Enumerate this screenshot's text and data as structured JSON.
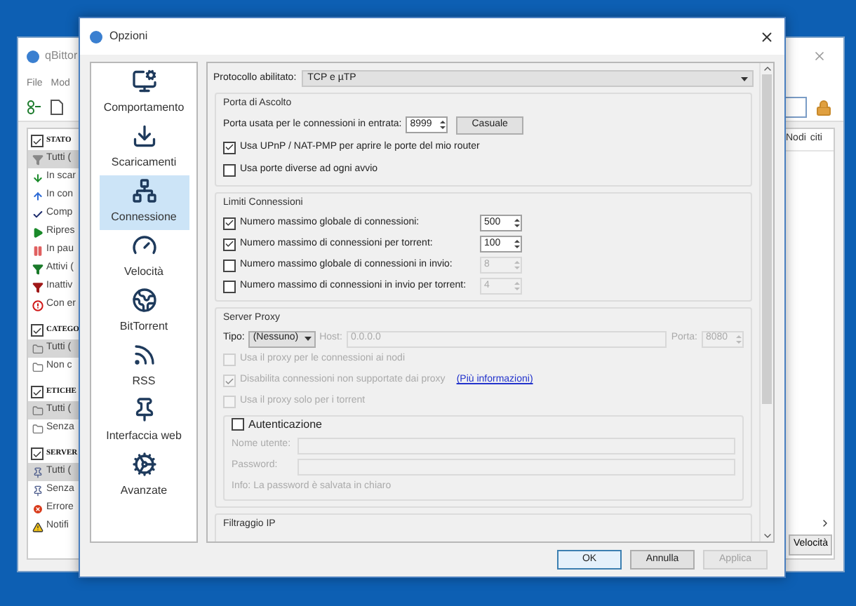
{
  "background_window": {
    "title": "qBittor",
    "menu": [
      "File",
      "Mod"
    ],
    "sidebar": [
      {
        "heading": "STATO",
        "checked": true,
        "items": [
          {
            "label": "Tutti (",
            "selected": true
          },
          {
            "label": "In scar",
            "selected": false
          },
          {
            "label": "In con",
            "selected": false
          },
          {
            "label": "Comp",
            "selected": false
          },
          {
            "label": "Ripres",
            "selected": false
          },
          {
            "label": "In pau",
            "selected": false
          },
          {
            "label": "Attivi (",
            "selected": false
          },
          {
            "label": "Inattiv",
            "selected": false
          },
          {
            "label": "Con er",
            "selected": false
          }
        ]
      },
      {
        "heading": "CATEGO",
        "checked": true,
        "items": [
          {
            "label": "Tutti (",
            "selected": true
          },
          {
            "label": "Non c",
            "selected": false
          }
        ]
      },
      {
        "heading": "ETICHE",
        "checked": true,
        "items": [
          {
            "label": "Tutti (",
            "selected": true
          },
          {
            "label": "Senza",
            "selected": false
          }
        ]
      },
      {
        "heading": "SERVER",
        "checked": true,
        "items": [
          {
            "label": "Tutti (",
            "selected": true
          },
          {
            "label": "Senza",
            "selected": false
          },
          {
            "label": "Errore",
            "selected": false
          },
          {
            "label": "Notifi",
            "selected": false
          }
        ]
      }
    ],
    "column_headers": [
      "Nodi",
      "citi"
    ],
    "speed_button": "Velocità"
  },
  "dialog": {
    "title": "Opzioni",
    "categories": [
      {
        "label": "Comportamento",
        "selected": false
      },
      {
        "label": "Scaricamenti",
        "selected": false
      },
      {
        "label": "Connessione",
        "selected": true
      },
      {
        "label": "Velocità",
        "selected": false
      },
      {
        "label": "BitTorrent",
        "selected": false
      },
      {
        "label": "RSS",
        "selected": false
      },
      {
        "label": "Interfaccia web",
        "selected": false
      },
      {
        "label": "Avanzate",
        "selected": false
      }
    ],
    "protocol": {
      "label": "Protocollo abilitato:",
      "value": "TCP e µTP"
    },
    "listening_port": {
      "title": "Porta di Ascolto",
      "port_label": "Porta usata per le connessioni in entrata:",
      "port_value": "8999",
      "random_button": "Casuale",
      "options": [
        {
          "label": "Usa UPnP / NAT-PMP per aprire le porte del mio router",
          "checked": true
        },
        {
          "label": "Usa porte diverse ad ogni avvio",
          "checked": false
        }
      ]
    },
    "connection_limits": {
      "title": "Limiti Connessioni",
      "rows": [
        {
          "label": "Numero massimo globale di connessioni:",
          "checked": true,
          "value": "500"
        },
        {
          "label": "Numero massimo di connessioni per torrent:",
          "checked": true,
          "value": "100"
        },
        {
          "label": "Numero massimo globale di connessioni in invio:",
          "checked": false,
          "value": "8"
        },
        {
          "label": "Numero massimo di connessioni in invio per torrent:",
          "checked": false,
          "value": "4"
        }
      ]
    },
    "proxy": {
      "title": "Server Proxy",
      "type_label": "Tipo:",
      "type_value": "(Nessuno)",
      "host_label": "Host:",
      "host_value": "0.0.0.0",
      "host_disabled": true,
      "port_label": "Porta:",
      "port_value": "8080",
      "options": [
        {
          "label": "Usa il proxy per le connessioni ai nodi",
          "checked": false,
          "disabled": true
        },
        {
          "label": "Disabilita connessioni non supportate dai proxy",
          "checked": true,
          "disabled": true,
          "link": "(Più informazioni)"
        },
        {
          "label": "Usa il proxy solo per i torrent",
          "checked": false,
          "disabled": true
        }
      ],
      "auth": {
        "label": "Autenticazione",
        "checked": false,
        "username_label": "Nome utente:",
        "password_label": "Password:",
        "info": "Info: La password è salvata in chiaro"
      }
    },
    "ip_filter": {
      "title": "Filtraggio IP"
    },
    "buttons": [
      {
        "label": "OK",
        "kind": "default"
      },
      {
        "label": "Annulla",
        "kind": "normal"
      },
      {
        "label": "Applica",
        "kind": "disabled"
      }
    ]
  }
}
